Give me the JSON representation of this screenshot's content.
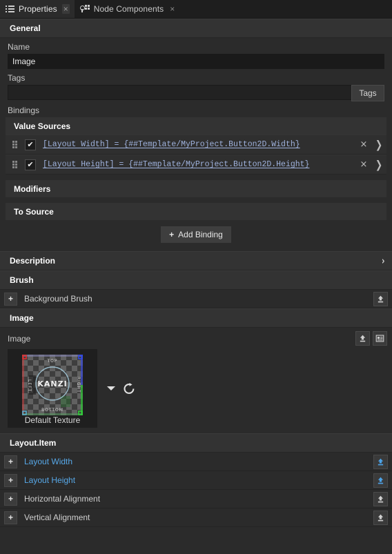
{
  "window": {
    "tabs": [
      {
        "label": "Properties",
        "icon": "list-square-icon",
        "close": "×",
        "active": true
      },
      {
        "label": "Node Components",
        "icon": "node-component-icon",
        "close": "×",
        "active": false
      }
    ]
  },
  "sections": {
    "general": {
      "title": "General",
      "chevron": "ⱟ"
    },
    "bindings_label": "Bindings",
    "value_sources": {
      "title": "Value Sources",
      "chevron": "ⱟ"
    },
    "modifiers": {
      "title": "Modifiers",
      "chevron": "ⱟ"
    },
    "to_source": {
      "title": "To Source",
      "chevron": "ⱟ"
    },
    "description": {
      "title": "Description",
      "chevron": "›"
    },
    "brush": {
      "title": "Brush",
      "chevron": "ⱟ"
    },
    "image": {
      "title": "Image",
      "chevron": "ⱟ"
    },
    "layout_item": {
      "title": "Layout.Item",
      "chevron": "ⱟ"
    }
  },
  "general": {
    "name_label": "Name",
    "name_value": "Image",
    "tags_label": "Tags",
    "tags_value": "",
    "tags_placeholder": "",
    "tags_button": "Tags"
  },
  "value_sources": {
    "rows": [
      {
        "checked": true,
        "check_glyph": "✔",
        "expression": "[Layout Width] = {##Template/MyProject.Button2D.Width}",
        "remove": "×",
        "expand": "❯"
      },
      {
        "checked": true,
        "check_glyph": "✔",
        "expression": "[Layout Height] = {##Template/MyProject.Button2D.Height}",
        "remove": "×",
        "expand": "❯"
      }
    ]
  },
  "add_binding": {
    "plus": "+",
    "label": "Add Binding"
  },
  "brush": {
    "rows": [
      {
        "plus": "+",
        "name": "Background Brush",
        "linked": false,
        "upload_color": "#cfcfcf"
      }
    ]
  },
  "image_block": {
    "label": "Image",
    "buttons": [
      {
        "name": "upload-icon"
      },
      {
        "name": "properties-list-icon"
      }
    ],
    "thumbnail": {
      "caption": "Default Texture",
      "texture_labels": {
        "top": "TOP",
        "bottom": "BOTTOM",
        "left": "LEFT",
        "right": "RIGHT",
        "center": "KANZI"
      },
      "corner_colors": {
        "top_left": "#d42020",
        "top_right": "#2436d8",
        "bottom_right": "#27c72c",
        "bottom_left": "#3aa0c0"
      }
    },
    "dropdown_arrow": "▼",
    "reset_icon": "reset-arrow-icon"
  },
  "layout_item": {
    "rows": [
      {
        "plus": "+",
        "name": "Layout Width",
        "linked": true,
        "upload_color": "#4da3e8"
      },
      {
        "plus": "+",
        "name": "Layout Height",
        "linked": true,
        "upload_color": "#4da3e8"
      },
      {
        "plus": "+",
        "name": "Horizontal Alignment",
        "linked": false,
        "upload_color": "#cfcfcf"
      },
      {
        "plus": "+",
        "name": "Vertical Alignment",
        "linked": false,
        "upload_color": "#cfcfcf"
      }
    ]
  },
  "colors": {
    "panel_bg": "#2b2b2b",
    "header_bg": "#333333",
    "tabbar_bg": "#1e1e1e",
    "input_bg": "#1a1a1a",
    "link_blue": "#57a8e8",
    "expr_blue": "#9fb2dd"
  }
}
